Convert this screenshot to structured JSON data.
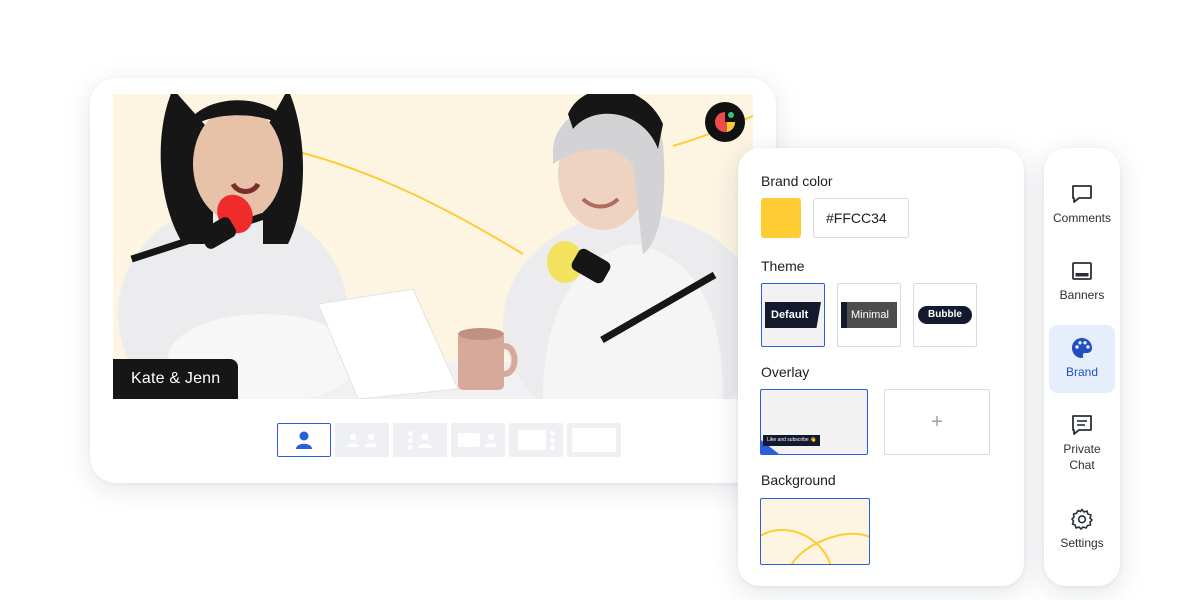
{
  "stage": {
    "name_tag": "Kate & Jenn",
    "layouts": [
      {
        "id": "solo",
        "active": true
      },
      {
        "id": "two-people"
      },
      {
        "id": "grid"
      },
      {
        "id": "sidebar"
      },
      {
        "id": "pip"
      },
      {
        "id": "screen"
      }
    ]
  },
  "brand": {
    "brand_color_label": "Brand color",
    "brand_color_value": "#FFCC34",
    "theme_label": "Theme",
    "themes": [
      {
        "label": "Default",
        "selected": true
      },
      {
        "label": "Minimal"
      },
      {
        "label": "Bubble"
      }
    ],
    "overlay_label": "Overlay",
    "overlay_caption": "Like and subscribe 👋",
    "overlay_add": "+",
    "background_label": "Background"
  },
  "sidebar": {
    "items": [
      {
        "label": "Comments",
        "icon": "comment-icon"
      },
      {
        "label": "Banners",
        "icon": "banner-icon"
      },
      {
        "label": "Brand",
        "icon": "palette-icon",
        "active": true
      },
      {
        "label": "Private Chat",
        "icon": "chat-icon"
      },
      {
        "label": "Settings",
        "icon": "gear-icon"
      }
    ]
  },
  "colors": {
    "accent": "#2A5FD8",
    "brand": "#FFCC34",
    "dark": "#141A2E",
    "video_bg": "#FDF5E2"
  }
}
